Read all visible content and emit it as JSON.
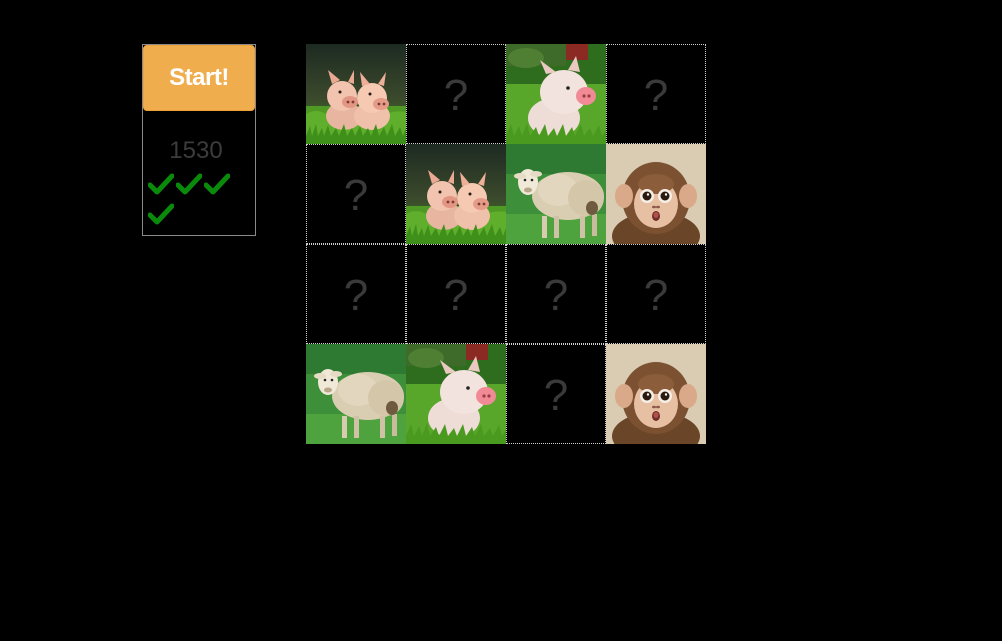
{
  "panel": {
    "start_label": "Start!",
    "score": "1530",
    "check_count": 4,
    "check_color": "#0a8a0a",
    "button_color": "#f0ad4e"
  },
  "board": {
    "hidden_symbol": "?",
    "tiles": [
      {
        "state": "revealed",
        "animal": "two-pigs"
      },
      {
        "state": "hidden"
      },
      {
        "state": "revealed",
        "animal": "piglet"
      },
      {
        "state": "hidden"
      },
      {
        "state": "hidden"
      },
      {
        "state": "revealed",
        "animal": "two-pigs"
      },
      {
        "state": "revealed",
        "animal": "sheep"
      },
      {
        "state": "revealed",
        "animal": "monkey"
      },
      {
        "state": "hidden"
      },
      {
        "state": "hidden"
      },
      {
        "state": "hidden"
      },
      {
        "state": "hidden"
      },
      {
        "state": "revealed",
        "animal": "sheep"
      },
      {
        "state": "revealed",
        "animal": "piglet"
      },
      {
        "state": "hidden"
      },
      {
        "state": "revealed",
        "animal": "monkey"
      }
    ]
  }
}
